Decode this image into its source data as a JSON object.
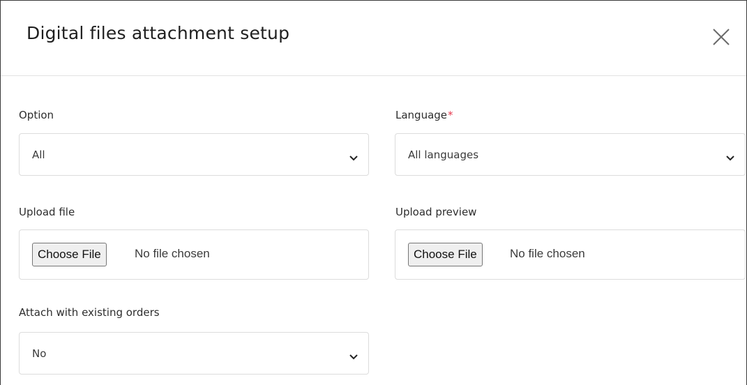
{
  "dialog": {
    "title": "Digital files attachment setup",
    "close_icon": "close-icon"
  },
  "form": {
    "option": {
      "label": "Option",
      "value": "All"
    },
    "language": {
      "label": "Language",
      "required_mark": "*",
      "value": "All languages"
    },
    "upload_file": {
      "label": "Upload file",
      "button_label": "Choose File",
      "status": "No file chosen"
    },
    "upload_preview": {
      "label": "Upload preview",
      "button_label": "Choose File",
      "status": "No file chosen"
    },
    "attach_existing": {
      "label": "Attach with existing orders",
      "value": "No"
    }
  },
  "colors": {
    "required": "#e63a4f",
    "border": "#dcdcdc"
  }
}
